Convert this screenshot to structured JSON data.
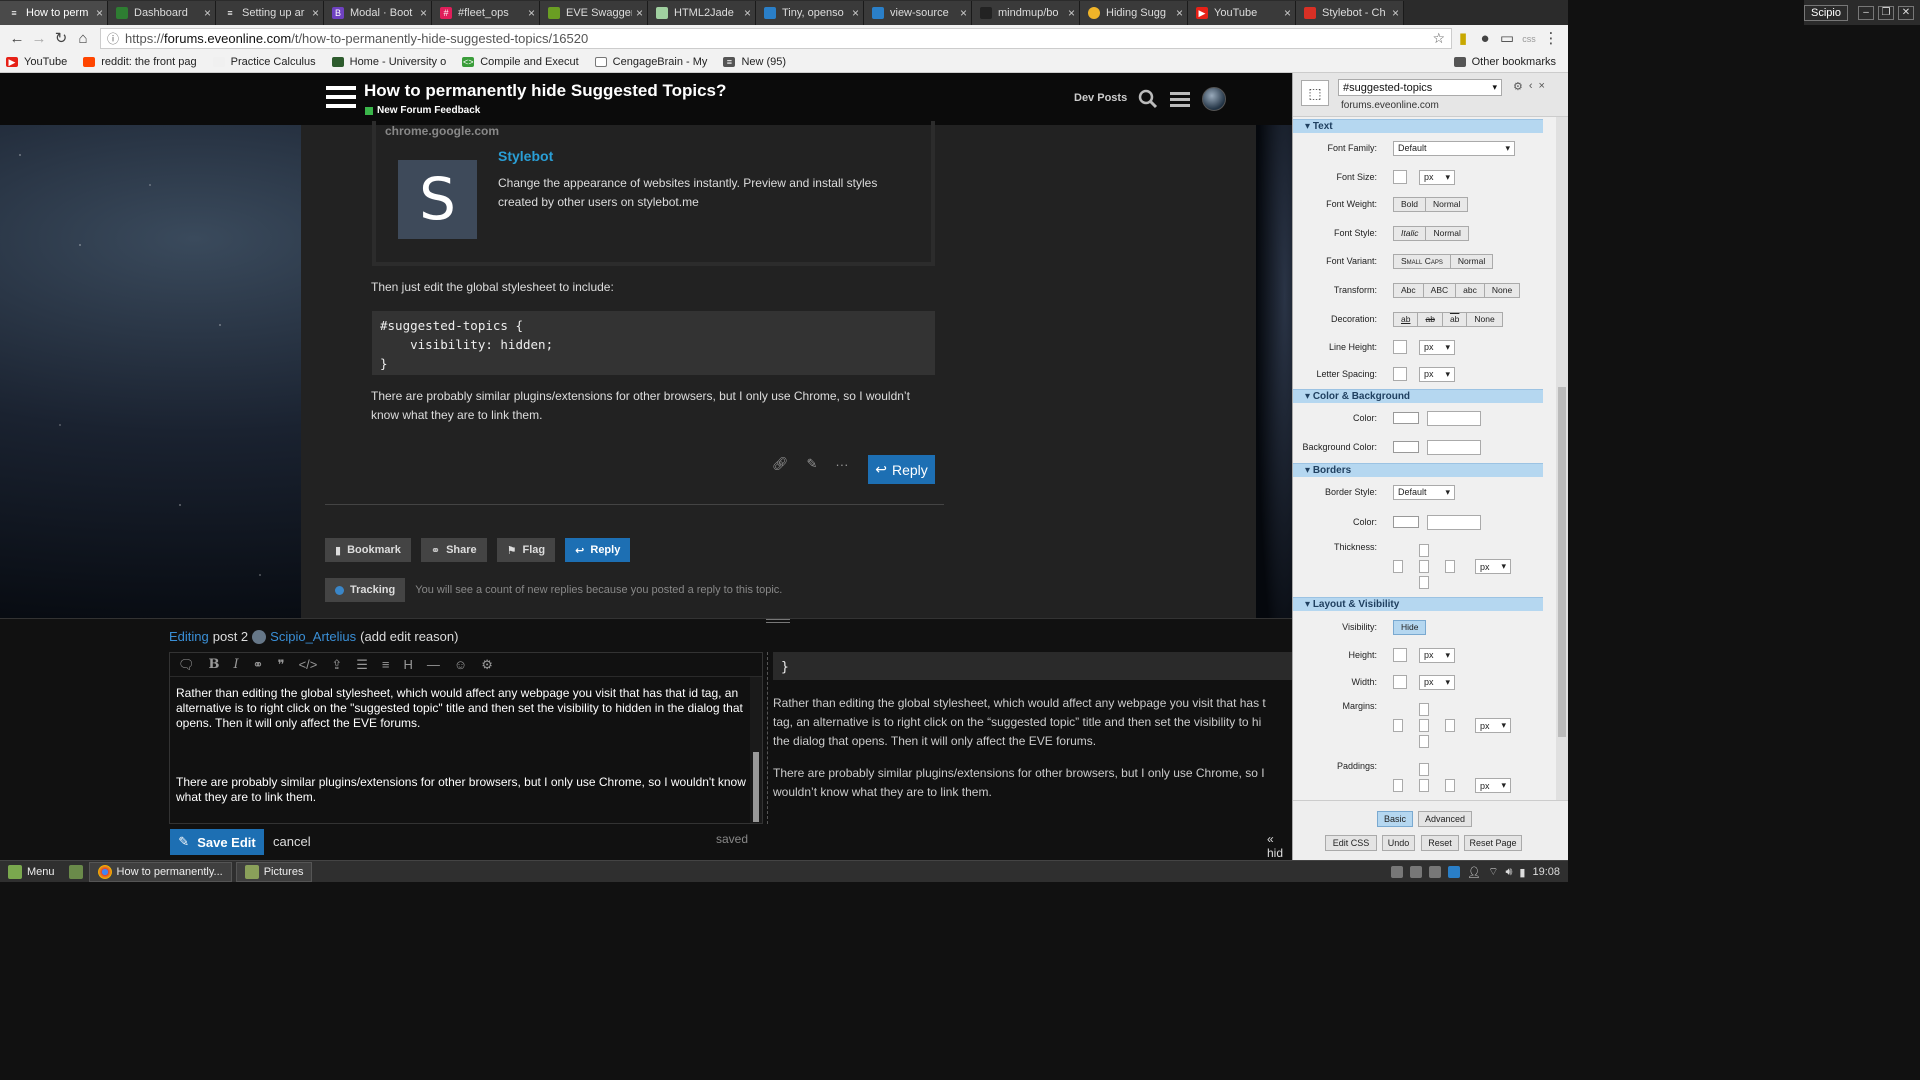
{
  "browser": {
    "tabs": [
      {
        "label": "How to perm",
        "icon": "menu-icon",
        "active": true,
        "color": "#4a4a4a"
      },
      {
        "label": "Dashboard",
        "icon": "dashboard-icon",
        "color": "#2e7d32"
      },
      {
        "label": "Setting up ar",
        "icon": "doc-icon",
        "color": "#555555"
      },
      {
        "label": "Modal · Boot",
        "icon": "bootstrap-icon",
        "color": "#6f42c1"
      },
      {
        "label": "#fleet_ops",
        "icon": "slack-icon",
        "color": "#e01e5a"
      },
      {
        "label": "EVE Swagger",
        "icon": "swagger-icon",
        "color": "#6a9e23"
      },
      {
        "label": "HTML2Jade",
        "icon": "jade-icon",
        "color": "#a0d0a0"
      },
      {
        "label": "Tiny, openso",
        "icon": "tiny-icon",
        "color": "#2a7fc8"
      },
      {
        "label": "view-source",
        "icon": "source-icon",
        "color": "#2a7fc8"
      },
      {
        "label": "mindmup/bo",
        "icon": "github-icon",
        "color": "#222222"
      },
      {
        "label": "Hiding Sugg",
        "icon": "discourse-icon",
        "color": "#f0b429"
      },
      {
        "label": "YouTube",
        "icon": "youtube-icon",
        "color": "#e62117"
      },
      {
        "label": "Stylebot - Ch",
        "icon": "webstore-icon",
        "color": "#d93025"
      }
    ],
    "user": "Scipio",
    "url_prefix": "https://",
    "url_host": "forums.eveonline.com",
    "url_path": "/t/how-to-permanently-hide-suggested-topics/16520",
    "bookmarks": [
      {
        "label": "YouTube",
        "color": "#e62117"
      },
      {
        "label": "reddit: the front pag",
        "color": "#ff4500"
      },
      {
        "label": "Practice Calculus",
        "color": "#f0f0f0"
      },
      {
        "label": "Home - University o",
        "color": "#2e5c2e"
      },
      {
        "label": "Compile and Execut",
        "color": "#3a9d3a"
      },
      {
        "label": "CengageBrain - My",
        "color": "#ffffff"
      },
      {
        "label": "New (95)",
        "color": "#555555"
      }
    ],
    "other_bookmarks": "Other bookmarks"
  },
  "forum": {
    "topic_title": "How to permanently hide Suggested Topics?",
    "category": "New Forum Feedback",
    "category_color": "#3ab54a",
    "dev_posts": "Dev Posts",
    "onebox": {
      "source": "chrome.google.com",
      "image_letter": "S",
      "title": "Stylebot",
      "description": "Change the appearance of websites instantly. Preview and install styles created by other users on stylebot.me"
    },
    "text1": "Then just edit the global stylesheet to include:",
    "code": "#suggested-topics {\n    visibility: hidden;\n}",
    "text2": "There are probably similar plugins/extensions for other browsers, but I only use Chrome, so I wouldn’t know what they are to link them.",
    "reply_label": "Reply",
    "footer": {
      "bookmark": "Bookmark",
      "share": "Share",
      "flag": "Flag",
      "reply": "Reply"
    },
    "tracking_label": "Tracking",
    "tracking_text": "You will see a count of new replies because you posted a reply to this topic."
  },
  "composer": {
    "editing": "Editing",
    "post": "post 2",
    "user": "Scipio_Artelius",
    "reason": "(add edit reason)",
    "para1": "Rather than editing the global stylesheet, which would affect any webpage you visit that has that id tag, an alternative is to right click on the \"suggested topic\" title and then set the visibility to hidden in the dialog that opens. Then it will only affect the EVE forums.",
    "para2": "There are probably similar plugins/extensions for other browsers, but I only use Chrome, so I wouldn't know what they are to link them.",
    "preview_code_line": "}",
    "preview_l1": "Rather than editing the global stylesheet, which would affect any webpage you visit that has t",
    "preview_l2": "tag, an alternative is to right click on the “suggested topic” title and then set the visibility to hi",
    "preview_l3": "the dialog that opens. Then it will only affect the EVE forums.",
    "preview_l4": "There are probably similar plugins/extensions for other browsers, but I only use Chrome, so I",
    "preview_l5": "wouldn’t know what they are to link them.",
    "save_label": "Save Edit",
    "cancel_label": "cancel",
    "saved_label": "saved",
    "hide_preview": "« hid"
  },
  "stylebot": {
    "selector": "#suggested-topics",
    "domain": "forums.eveonline.com",
    "sections": {
      "text": "Text",
      "color": "Color & Background",
      "borders": "Borders",
      "layout": "Layout & Visibility"
    },
    "labels": {
      "font_family": "Font Family:",
      "font_size": "Font Size:",
      "font_weight": "Font Weight:",
      "font_style": "Font Style:",
      "font_variant": "Font Variant:",
      "transform": "Transform:",
      "decoration": "Decoration:",
      "line_height": "Line Height:",
      "letter_spacing": "Letter Spacing:",
      "color": "Color:",
      "background_color": "Background Color:",
      "border_style": "Border Style:",
      "border_color": "Color:",
      "thickness": "Thickness:",
      "visibility": "Visibility:",
      "height": "Height:",
      "width": "Width:",
      "margins": "Margins:",
      "paddings": "Paddings:"
    },
    "values": {
      "font_family": "Default",
      "unit": "px",
      "border_style": "Default",
      "bold": "Bold",
      "normal": "Normal",
      "italic": "Italic",
      "small_caps": "Small Caps",
      "abc_cap": "Abc",
      "abc_up": "ABC",
      "abc_low": "abc",
      "none": "None",
      "ab": "ab",
      "hide": "Hide"
    },
    "footer": {
      "basic": "Basic",
      "advanced": "Advanced",
      "edit_css": "Edit CSS",
      "undo": "Undo",
      "reset": "Reset",
      "reset_page": "Reset Page"
    }
  },
  "taskbar": {
    "menu": "Menu",
    "windows": [
      {
        "label": "How to permanently...",
        "icon": "chrome-icon"
      },
      {
        "label": "Pictures",
        "icon": "folder-icon"
      }
    ],
    "clock": "19:08"
  }
}
